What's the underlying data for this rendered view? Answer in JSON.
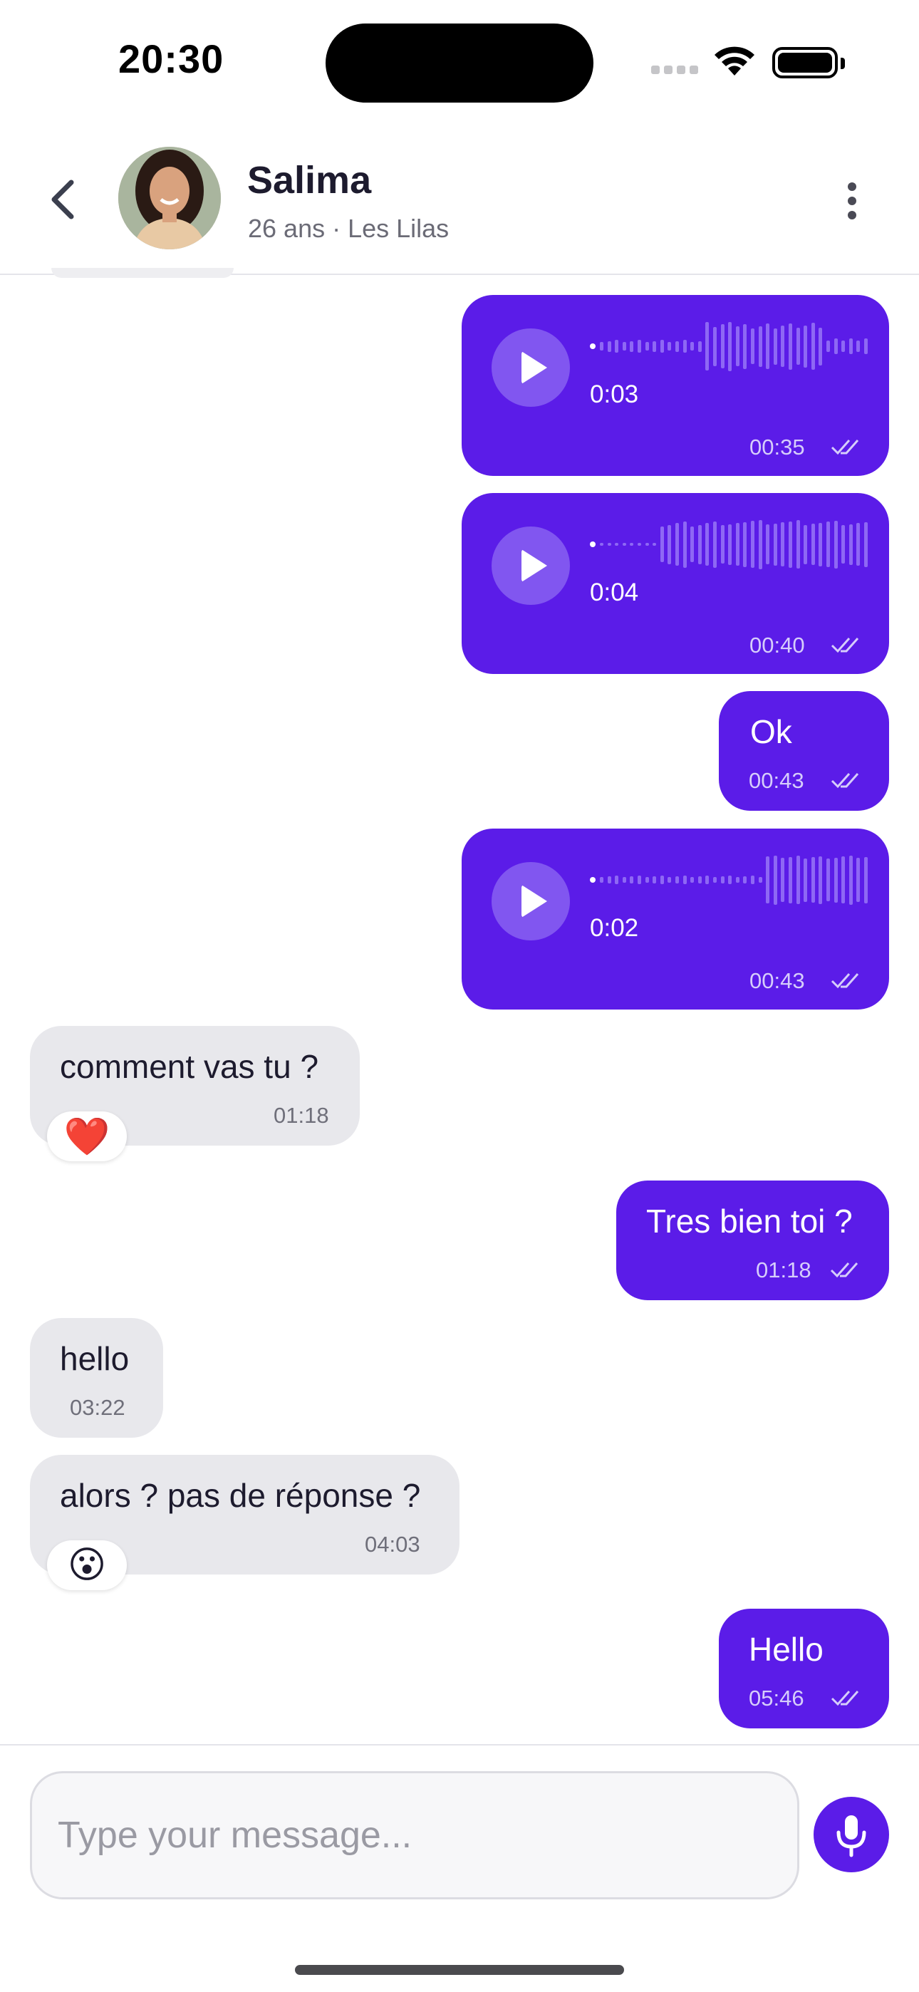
{
  "status_bar": {
    "time": "20:30"
  },
  "header": {
    "contact_name": "Salima",
    "contact_subtitle": "26 ans · Les Lilas"
  },
  "messages": [
    {
      "type": "voice",
      "direction": "out",
      "duration": "0:03",
      "time": "00:35",
      "read": true
    },
    {
      "type": "voice",
      "direction": "out",
      "duration": "0:04",
      "time": "00:40",
      "read": true
    },
    {
      "type": "text",
      "direction": "out",
      "text": "Ok",
      "time": "00:43",
      "read": true
    },
    {
      "type": "voice",
      "direction": "out",
      "duration": "0:02",
      "time": "00:43",
      "read": true
    },
    {
      "type": "text",
      "direction": "in",
      "text": "comment vas tu ?",
      "time": "01:18",
      "reaction": "❤️"
    },
    {
      "type": "text",
      "direction": "out",
      "text": "Tres bien toi ?",
      "time": "01:18",
      "read": true
    },
    {
      "type": "text",
      "direction": "in",
      "text": "hello",
      "time": "03:22"
    },
    {
      "type": "text",
      "direction": "in",
      "text": "alors ? pas de réponse ?",
      "time": "04:03",
      "reaction": "😮"
    },
    {
      "type": "text",
      "direction": "out",
      "text": "Hello",
      "time": "05:46",
      "read": true
    }
  ],
  "input": {
    "placeholder": "Type your message..."
  },
  "colors": {
    "outgoing_bubble": "#5b1ce8",
    "incoming_bubble": "#e8e8ec",
    "accent": "#5b1ce8"
  },
  "icons": {
    "back": "chevron-left-icon",
    "more": "more-vertical-icon",
    "play": "play-icon",
    "read": "double-check-icon",
    "mic": "microphone-icon"
  }
}
